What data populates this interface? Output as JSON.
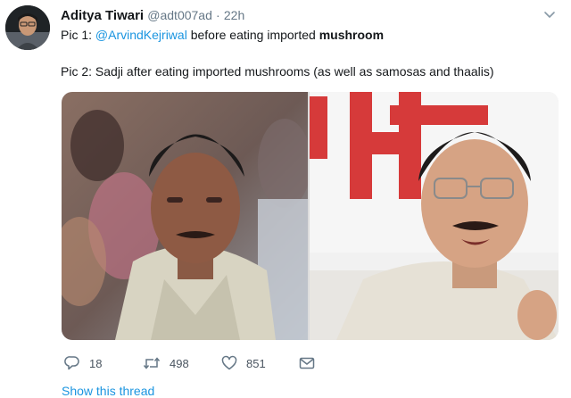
{
  "tweet": {
    "author_name": "Aditya Tiwari",
    "handle": "@adt007ad",
    "separator": "·",
    "time": "22h",
    "line1_prefix": "Pic 1: ",
    "line1_mention": "@ArvindKejriwal",
    "line1_middle": " before eating imported ",
    "line1_bold": "mushroom",
    "line2": "Pic 2: Sadji after eating imported mushrooms (as well as samosas and thaalis)"
  },
  "actions": {
    "replies": "18",
    "retweets": "498",
    "likes": "851"
  },
  "footer": {
    "show_thread": "Show this thread"
  },
  "icons": {
    "caret": "chevron-down-icon",
    "reply": "reply-icon",
    "retweet": "retweet-icon",
    "like": "heart-icon",
    "dm": "envelope-icon"
  },
  "colors": {
    "link": "#1b95e0",
    "secondary_text": "#657786",
    "icon": "#657786"
  }
}
